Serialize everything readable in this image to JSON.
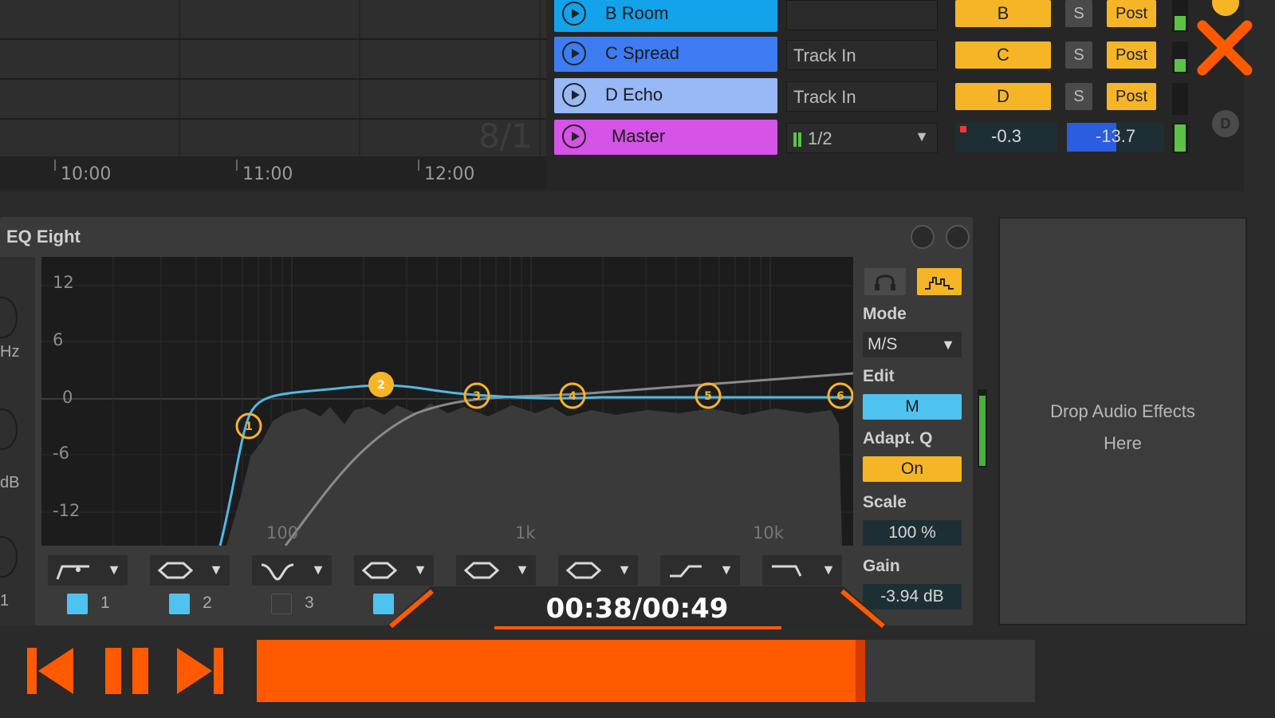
{
  "arrangement": {
    "position_display": "8/1",
    "timeline": [
      "10:00",
      "11:00",
      "12:00"
    ]
  },
  "tracks": [
    {
      "name": "B Room",
      "input": "",
      "send": "B",
      "solo": "S",
      "post": "Post",
      "color": "#12a3ea"
    },
    {
      "name": "C Spread",
      "input": "Track In",
      "send": "C",
      "solo": "S",
      "post": "Post",
      "color": "#3d7cf2"
    },
    {
      "name": "D Echo",
      "input": "Track In",
      "send": "D",
      "solo": "S",
      "post": "Post",
      "color": "#98b9f6"
    }
  ],
  "master": {
    "name": "Master",
    "output": "1/2",
    "pan": "-0.3",
    "volume": "-13.7",
    "color": "#d553e6"
  },
  "device": {
    "title": "EQ Eight",
    "y_labels": [
      "12",
      "6",
      "0",
      "-6",
      "-12"
    ],
    "x_labels": [
      "100",
      "1k",
      "10k"
    ],
    "bands": [
      {
        "num": "1",
        "enabled": true
      },
      {
        "num": "2",
        "enabled": true
      },
      {
        "num": "3",
        "enabled": false
      },
      {
        "num": "4",
        "enabled": true
      }
    ],
    "band_markers": [
      "1",
      "2",
      "3",
      "4",
      "5",
      "6"
    ],
    "mode_label": "Mode",
    "mode_value": "M/S",
    "edit_label": "Edit",
    "edit_value": "M",
    "adaptq_label": "Adapt. Q",
    "adaptq_value": "On",
    "scale_label": "Scale",
    "scale_value": "100 %",
    "gain_label": "Gain",
    "gain_value": "-3.94 dB",
    "left_fragments": [
      "Hz",
      "dB",
      "1"
    ]
  },
  "drop_zone": {
    "line1": "Drop Audio Effects",
    "line2": "Here"
  },
  "player": {
    "time": "00:38/00:49",
    "progress_fraction": 0.776,
    "accent": "#ff5a00"
  },
  "colors": {
    "send_orange": "#f6b526",
    "eq_blue": "#4fb9e3",
    "edit_blue": "#4fc3ef"
  }
}
